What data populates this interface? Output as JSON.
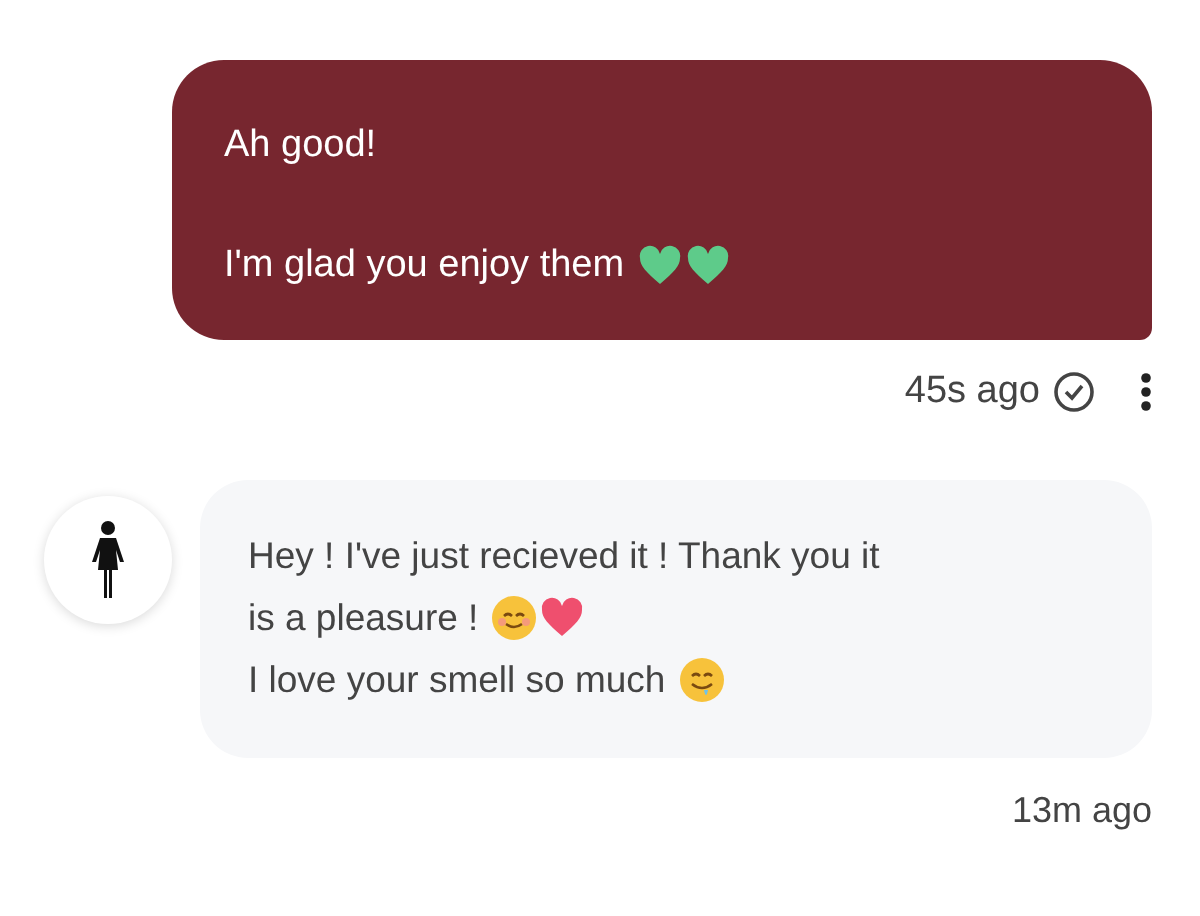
{
  "messages": [
    {
      "kind": "outgoing",
      "lines": [
        {
          "kind": "text",
          "text": "Ah good!"
        },
        {
          "kind": "gap"
        },
        {
          "kind": "text",
          "text": "I'm glad you enjoy them",
          "emojis": [
            {
              "kind": "green-heart"
            },
            {
              "kind": "green-heart"
            }
          ]
        }
      ],
      "time": "45s ago",
      "read": true
    },
    {
      "kind": "incoming",
      "lines": [
        {
          "kind": "text",
          "text": "Hey ! I've just recieved it ! Thank you it"
        },
        {
          "kind": "text",
          "text": "is a pleasure !",
          "emojis": [
            {
              "kind": "smile"
            },
            {
              "kind": "pink-heart"
            }
          ]
        },
        {
          "kind": "text",
          "text": "I love your smell so much",
          "emojis": [
            {
              "kind": "drool"
            }
          ]
        }
      ],
      "time": "13m ago"
    }
  ]
}
